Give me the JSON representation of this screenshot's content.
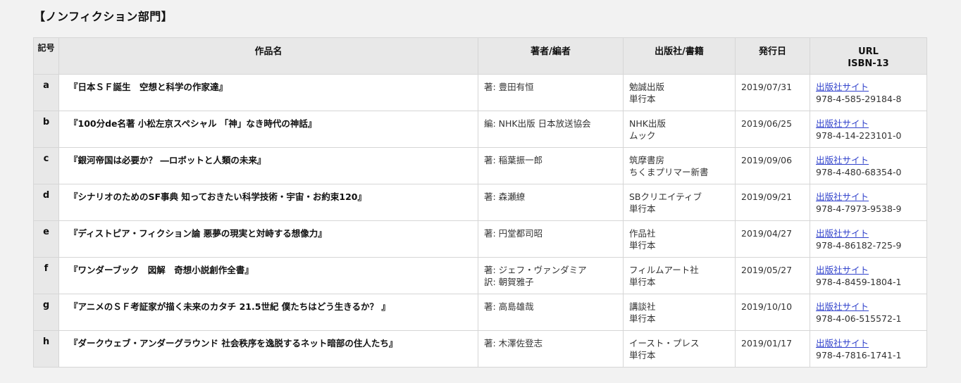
{
  "section": {
    "title": "【ノンフィクション部門】"
  },
  "table": {
    "headers": {
      "id": "記号",
      "title": "作品名",
      "author": "著者/編者",
      "publisher": "出版社/書籍",
      "date": "発行日",
      "url_line1": "URL",
      "url_line2": "ISBN-13"
    },
    "rows": [
      {
        "id": "a",
        "title": "『日本ＳＦ誕生　空想と科学の作家達』",
        "author1": "著: 豊田有恒",
        "author2": "",
        "publisher": "勉誠出版",
        "format": "単行本",
        "date": "2019/07/31",
        "link": "出版社サイト",
        "isbn": "978-4-585-29184-8"
      },
      {
        "id": "b",
        "title": "『100分de名著 小松左京スペシャル 「神」なき時代の神話』",
        "author1": "編: NHK出版 日本放送協会",
        "author2": "",
        "publisher": "NHK出版",
        "format": "ムック",
        "date": "2019/06/25",
        "link": "出版社サイト",
        "isbn": "978-4-14-223101-0"
      },
      {
        "id": "c",
        "title": "『銀河帝国は必要か？ ―ロボットと人類の未来』",
        "author1": "著: 稲葉振一郎",
        "author2": "",
        "publisher": "筑摩書房",
        "format": "ちくまプリマー新書",
        "date": "2019/09/06",
        "link": "出版社サイト",
        "isbn": "978-4-480-68354-0"
      },
      {
        "id": "d",
        "title": "『シナリオのためのSF事典 知っておきたい科学技術・宇宙・お約束120』",
        "author1": "著: 森瀬繚",
        "author2": "",
        "publisher": "SBクリエイティブ",
        "format": "単行本",
        "date": "2019/09/21",
        "link": "出版社サイト",
        "isbn": "978-4-7973-9538-9"
      },
      {
        "id": "e",
        "title": "『ディストピア・フィクション論 悪夢の現実と対峙する想像力』",
        "author1": "著: 円堂都司昭",
        "author2": "",
        "publisher": "作品社",
        "format": "単行本",
        "date": "2019/04/27",
        "link": "出版社サイト",
        "isbn": "978-4-86182-725-9"
      },
      {
        "id": "f",
        "title": "『ワンダーブック　図解　奇想小説創作全書』",
        "author1": "著: ジェフ・ヴァンダミア",
        "author2": "訳: 朝賀雅子",
        "publisher": "フィルムアート社",
        "format": "単行本",
        "date": "2019/05/27",
        "link": "出版社サイト",
        "isbn": "978-4-8459-1804-1"
      },
      {
        "id": "g",
        "title": "『アニメのＳＦ考証家が描く未来のカタチ 21.5世紀 僕たちはどう生きるか？ 』",
        "author1": "著: 高島雄哉",
        "author2": "",
        "publisher": "講談社",
        "format": "単行本",
        "date": "2019/10/10",
        "link": "出版社サイト",
        "isbn": "978-4-06-515572-1"
      },
      {
        "id": "h",
        "title": "『ダークウェブ・アンダーグラウンド 社会秩序を逸脱するネット暗部の住人たち』",
        "author1": "著: 木澤佐登志",
        "author2": "",
        "publisher": "イースト・プレス",
        "format": "単行本",
        "date": "2019/01/17",
        "link": "出版社サイト",
        "isbn": "978-4-7816-1741-1"
      }
    ]
  }
}
